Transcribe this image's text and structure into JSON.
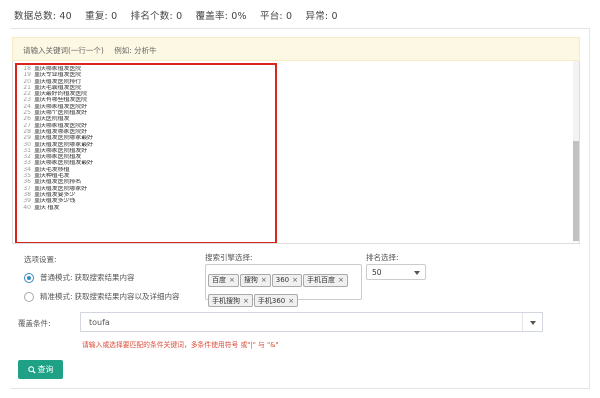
{
  "stats": {
    "total": "数据总数: 40",
    "duplicate": "重复: 0",
    "ranked": "排名个数: 0",
    "coverage": "覆盖率: 0%",
    "platforms": "平台: 0",
    "errors": "异常: 0"
  },
  "keyword_input": {
    "placeholder": "请输入关键词(一行一个)",
    "example": "例如: 分析牛"
  },
  "keywords": [
    {
      "num": "18",
      "text": "重庆哪家植发医院"
    },
    {
      "num": "19",
      "text": "重庆专业植发医院"
    },
    {
      "num": "20",
      "text": "重庆植发医院排行"
    },
    {
      "num": "21",
      "text": "重庆毛囊植发医院"
    },
    {
      "num": "22",
      "text": "重庆最好的植发医院"
    },
    {
      "num": "23",
      "text": "重庆有哪些植发医院"
    },
    {
      "num": "24",
      "text": "重庆哪家植发医院好"
    },
    {
      "num": "25",
      "text": "重庆哪个医院植发好"
    },
    {
      "num": "26",
      "text": "重庆医院植发"
    },
    {
      "num": "27",
      "text": "重庆哪家植发医院好"
    },
    {
      "num": "28",
      "text": "重庆植发哪家医院好"
    },
    {
      "num": "29",
      "text": "重庆植发医院哪家最好"
    },
    {
      "num": "30",
      "text": "重庆植发医院哪家最好"
    },
    {
      "num": "31",
      "text": "重庆哪家医院植发好"
    },
    {
      "num": "32",
      "text": "重庆哪家医院植发"
    },
    {
      "num": "33",
      "text": "重庆哪家医院植发最好"
    },
    {
      "num": "34",
      "text": "重庆毛发移植"
    },
    {
      "num": "35",
      "text": "重庆种植毛发"
    },
    {
      "num": "36",
      "text": "重庆植发医院排名"
    },
    {
      "num": "37",
      "text": "重庆植发医院哪家好"
    },
    {
      "num": "38",
      "text": "重庆植发要多少"
    },
    {
      "num": "39",
      "text": "重庆植发多少钱"
    },
    {
      "num": "40",
      "text": "重庆 植发"
    }
  ],
  "options": {
    "label": "选项设置:",
    "normal_mode": {
      "name": "普通模式:",
      "desc": "获取搜索结果内容"
    },
    "precise_mode": {
      "name": "精准模式:",
      "desc": "获取搜索结果内容以及详细内容"
    }
  },
  "engines": {
    "label": "搜索引擎选择:",
    "tags": [
      "百度",
      "搜狗",
      "360",
      "手机百度",
      "手机搜狗",
      "手机360"
    ]
  },
  "rank": {
    "label": "排名选择:",
    "value": "50"
  },
  "cover": {
    "label": "覆盖条件:",
    "value": "toufa",
    "hint": "请输入或选择要匹配的条件关键词，多条件使用符号 或\"|\" 与 \"&\""
  },
  "query_button": "查询",
  "colors": {
    "accent_green": "#1ea185",
    "highlight_red": "#d9251d",
    "hint_red": "#dd4b39",
    "hint_bg": "#fcf8e3"
  }
}
